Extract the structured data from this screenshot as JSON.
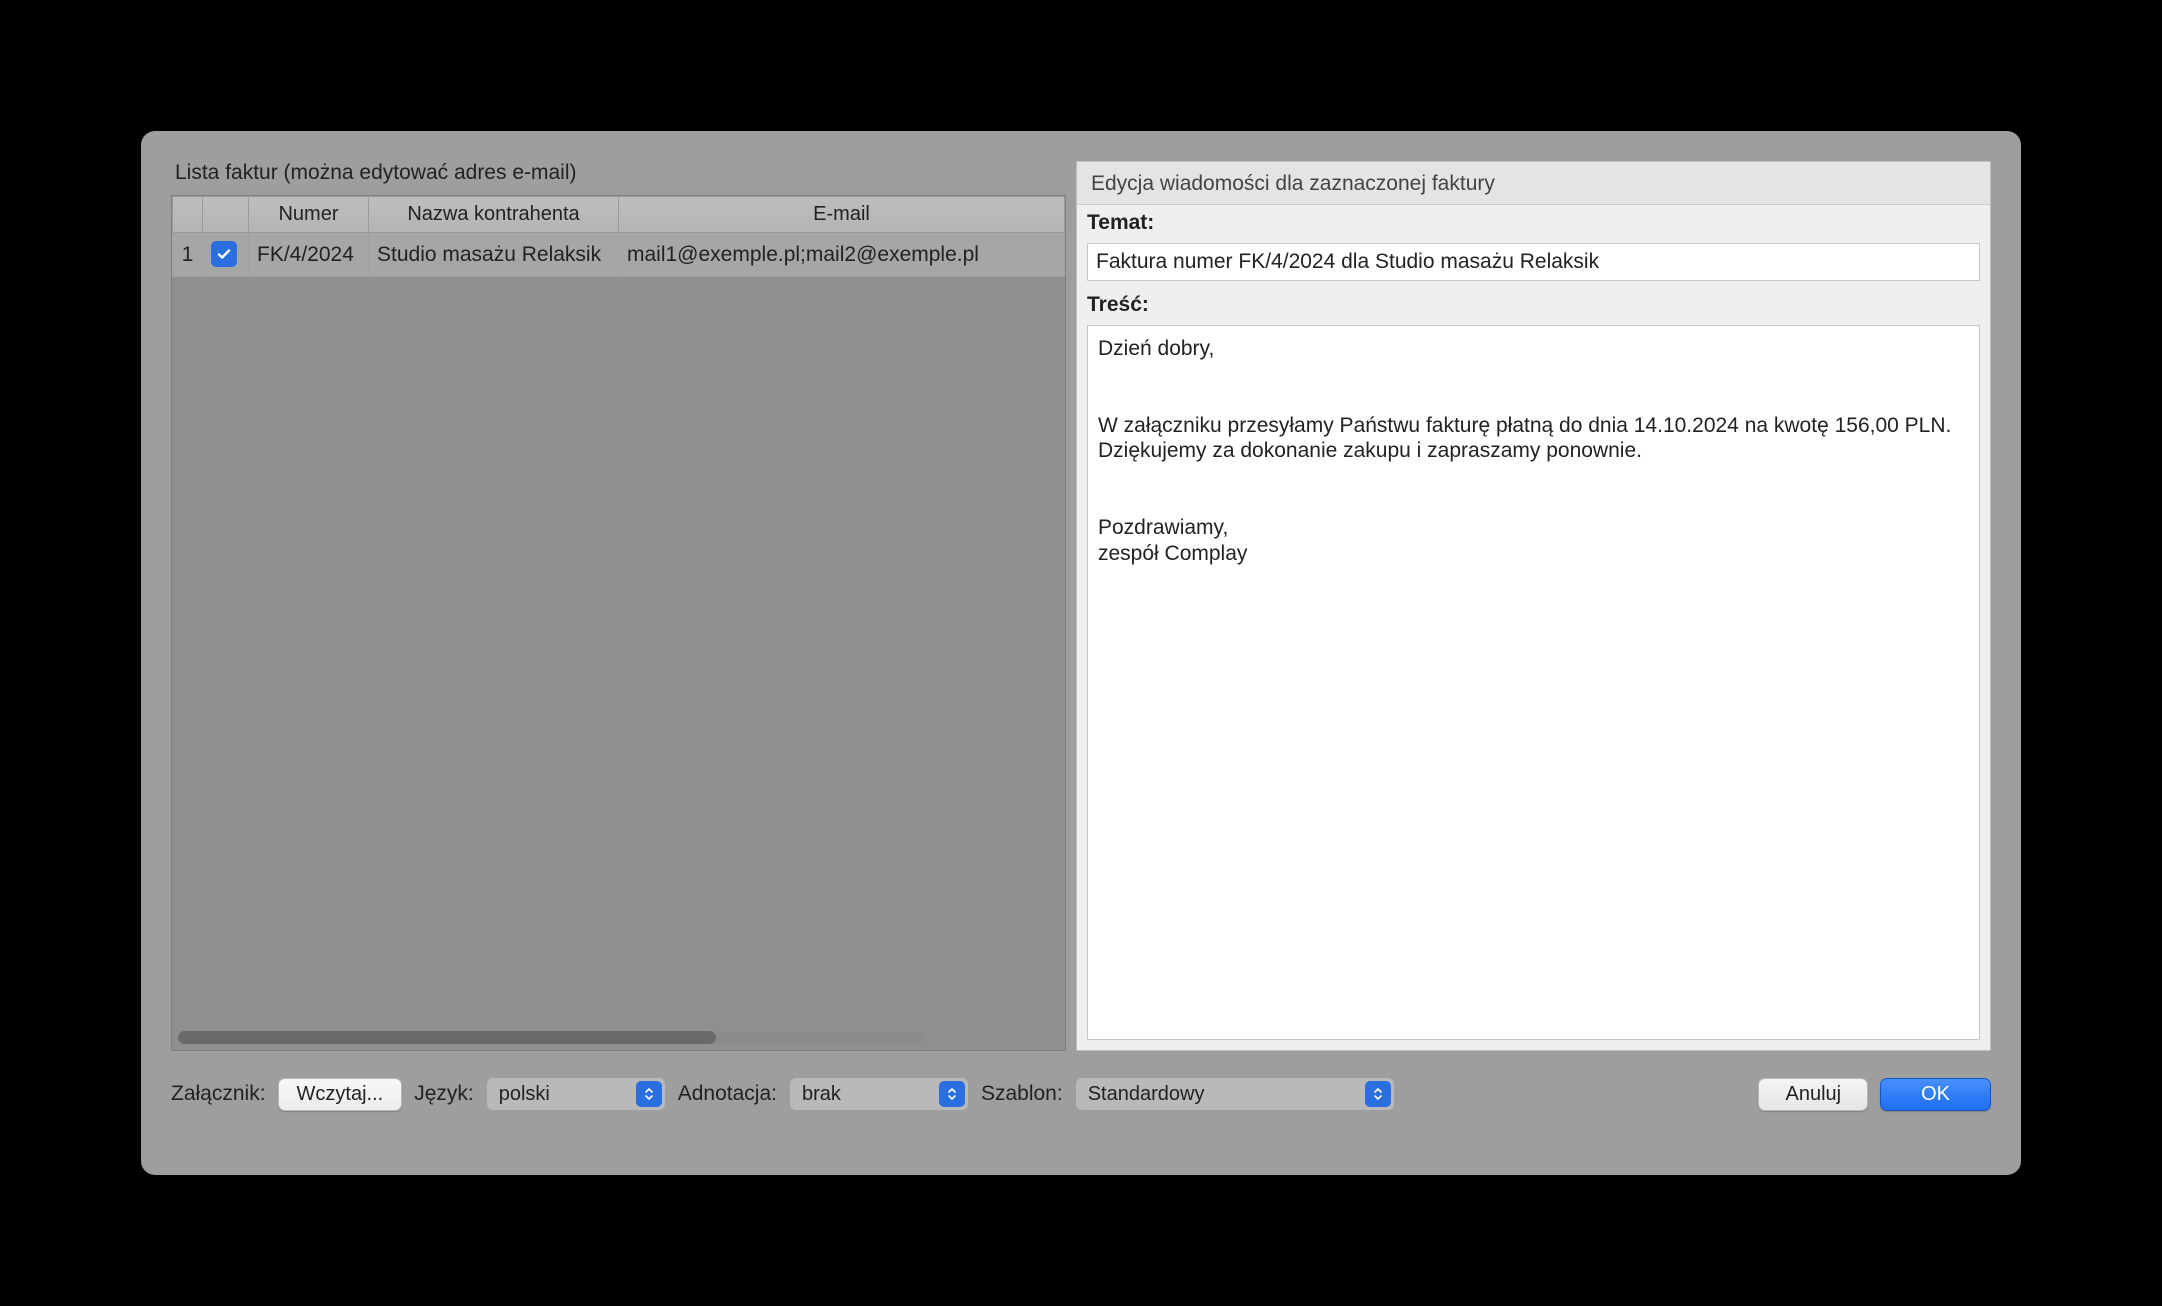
{
  "left": {
    "title": "Lista faktur (można edytować adres e-mail)",
    "columns": {
      "numer": "Numer",
      "nazwa": "Nazwa kontrahenta",
      "email": "E-mail"
    },
    "rows": [
      {
        "idx": "1",
        "checked": true,
        "numer": "FK/4/2024",
        "nazwa": "Studio masażu Relaksik",
        "email": "mail1@exemple.pl;mail2@exemple.pl"
      }
    ]
  },
  "right": {
    "header": "Edycja wiadomości dla zaznaczonej faktury",
    "subject_label": "Temat:",
    "subject_value": "Faktura numer FK/4/2024 dla Studio masażu Relaksik",
    "body_label": "Treść:",
    "body_value": "Dzień dobry,\n\n\nW załączniku przesyłamy Państwu fakturę płatną do dnia 14.10.2024 na kwotę 156,00 PLN. Dziękujemy za dokonanie zakupu i zapraszamy ponownie.\n\n\nPozdrawiamy,\nzespół Complay"
  },
  "bottom": {
    "attachment_label": "Załącznik:",
    "load_button": "Wczytaj...",
    "language_label": "Język:",
    "language_value": "polski",
    "annotation_label": "Adnotacja:",
    "annotation_value": "brak",
    "template_label": "Szablon:",
    "template_value": "Standardowy",
    "cancel": "Anuluj",
    "ok": "OK"
  }
}
